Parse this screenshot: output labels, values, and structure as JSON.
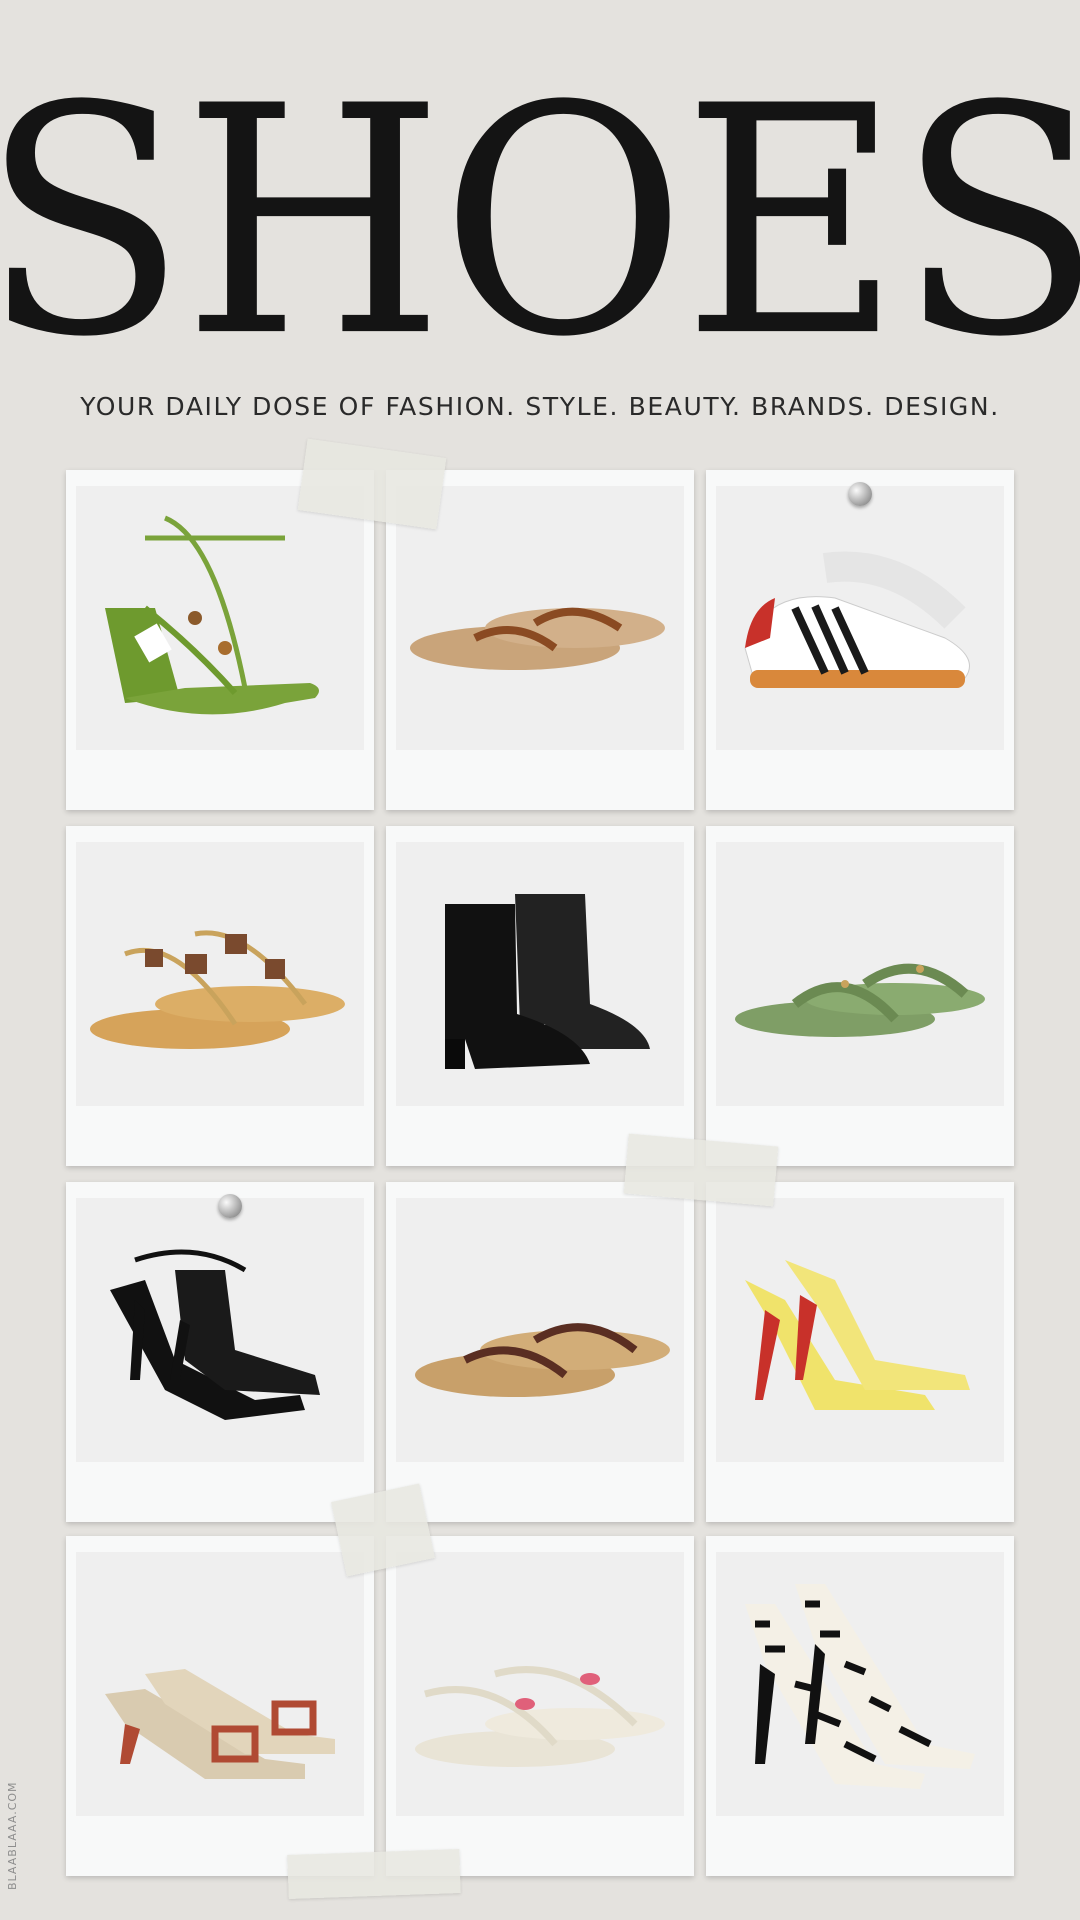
{
  "header": {
    "title": "SHOES",
    "tagline": "YOUR DAILY DOSE OF FASHION. STYLE. BEAUTY. BRANDS. DESIGN."
  },
  "cards": [
    {
      "name": "green-lace-up-wedge-sandal",
      "color": "#7aa33a"
    },
    {
      "name": "tan-leather-flip-flops",
      "color": "#a0522d"
    },
    {
      "name": "white-striped-sneakers",
      "color": "#1a1a1a"
    },
    {
      "name": "gold-embellished-thong-sandals",
      "color": "#c9a35c"
    },
    {
      "name": "black-leather-ankle-boots",
      "color": "#1a1a1a"
    },
    {
      "name": "green-studded-jelly-flip-flops",
      "color": "#7f9e66"
    },
    {
      "name": "black-strappy-heeled-sandals",
      "color": "#111111"
    },
    {
      "name": "raffia-thong-sandals",
      "color": "#c8a06a"
    },
    {
      "name": "yellow-patent-mules",
      "color": "#f0e36b"
    },
    {
      "name": "monogram-buckle-kitten-mules",
      "color": "#b04a33"
    },
    {
      "name": "white-flamingo-sandals",
      "color": "#e9e4d6"
    },
    {
      "name": "zebra-print-pumps",
      "color": "#222222"
    }
  ],
  "watermark": "BLAABLAAA.COM"
}
